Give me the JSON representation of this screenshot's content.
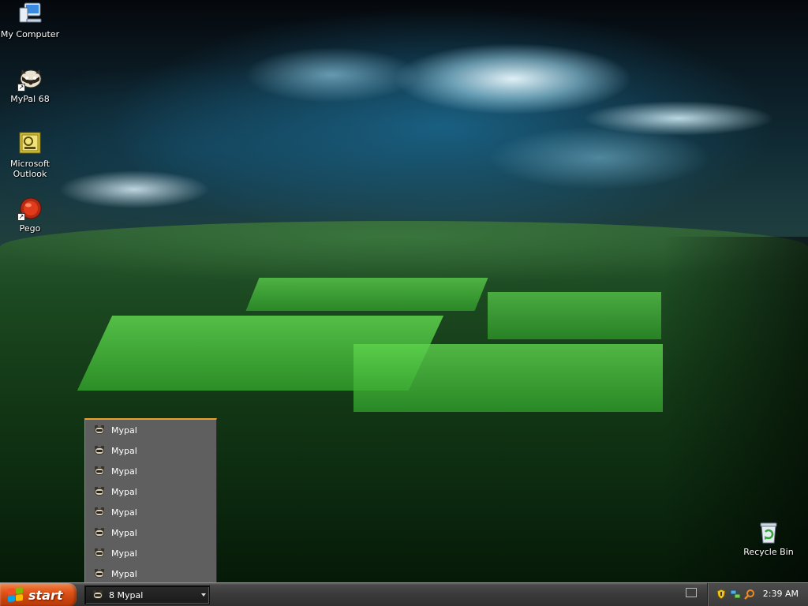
{
  "desktop": {
    "icons": [
      {
        "label": "My Computer",
        "icon": "my-computer-icon"
      },
      {
        "label": "MyPal 68",
        "icon": "mypal-icon"
      },
      {
        "label": "Microsoft\nOutlook",
        "icon": "outlook-icon"
      },
      {
        "label": "Pego",
        "icon": "pego-icon"
      },
      {
        "label": "Recycle Bin",
        "icon": "recycle-bin-icon"
      }
    ]
  },
  "taskbar_popup": {
    "items": [
      "Mypal",
      "Mypal",
      "Mypal",
      "Mypal",
      "Mypal",
      "Mypal",
      "Mypal",
      "Mypal"
    ]
  },
  "taskbar": {
    "start_label": "start",
    "group_button_label": "8 Mypal",
    "clock": "2:39 AM",
    "tray_icons": [
      "shield-icon",
      "network-icon",
      "search-icon"
    ]
  },
  "colors": {
    "start_orange": "#e2571c",
    "popup_accent": "#e9a12c",
    "taskbar_gray": "#3a3a3a"
  }
}
